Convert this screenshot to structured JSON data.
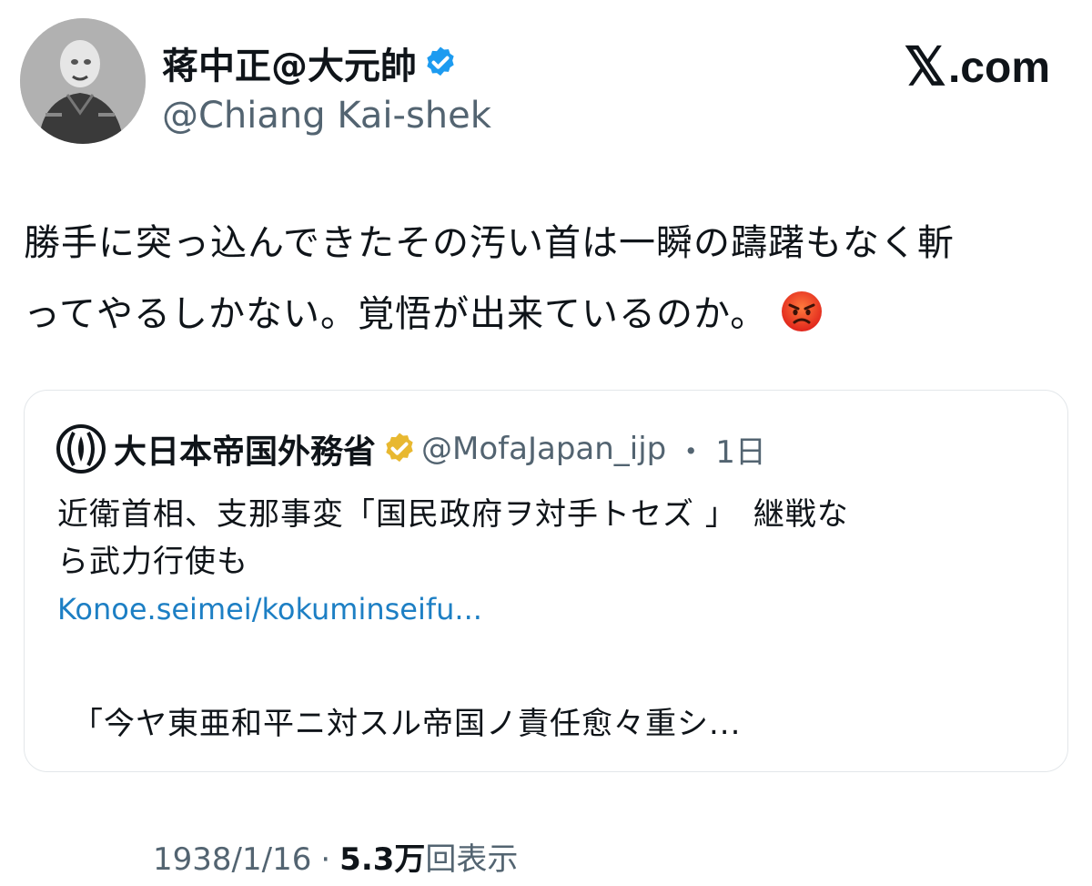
{
  "author": {
    "display_name": "蒋中正@大元帥",
    "handle": "@Chiang Kai-shek",
    "verified_color": "#1d9bf0"
  },
  "site_logo": {
    "glyph": "𝕏",
    "suffix": ".com"
  },
  "tweet": {
    "line1": "勝手に突っ込んできたその汚い首は一瞬の躊躇もなく斬",
    "line2": "ってやるしかない。覚悟が出来ているのか。",
    "emoji_icon": "angry-face-icon"
  },
  "quote": {
    "display_name": "大日本帝国外務省",
    "handle": "@MofaJapan_ijp",
    "separator": "・",
    "time": "1日",
    "verified_color": "#e8b830",
    "body_line1": "近衛首相、支那事変「国民政府ヲ対手トセズ 」　継戦な",
    "body_line2": "ら武力行使も",
    "link": "Konoe.seimei/kokuminseifu...",
    "excerpt": "「今ヤ東亜和平ニ対スル帝国ノ責任愈々重シ..."
  },
  "meta": {
    "date": "1938/1/16",
    "separator": "·",
    "views_count": "5.3万",
    "views_label": "回表示"
  },
  "colors": {
    "text_primary": "#0f1419",
    "text_secondary": "#536471",
    "link": "#1d7fc4",
    "card_border": "#e3e7ea"
  }
}
